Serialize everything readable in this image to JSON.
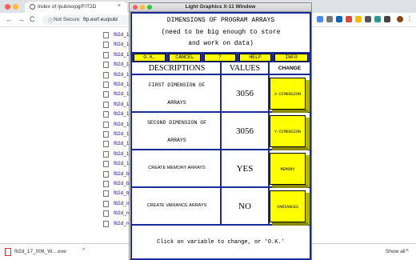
{
  "browser": {
    "tab_title": "Index of /pub/expg/FIT2D",
    "tab_close": "×",
    "new_tab": "+",
    "nav": {
      "back": "←",
      "forward": "→",
      "reload": "C"
    },
    "security_label": "Not Secure",
    "url": "ftp.esrf.eu/pub/",
    "menu": "⋮",
    "files": [
      "fit2d_12",
      "fit2d_12",
      "fit2d_12",
      "fit2d_12",
      "fit2d_12",
      "fit2d_14",
      "fit2d_14",
      "fit2d_16",
      "fit2d_16",
      "fit2d_17",
      "fit2d_17",
      "fit2d_17",
      "fit2d_17",
      "fit2d_17",
      "fit2d_be",
      "fit2d_be",
      "fit2d_be",
      "fit2d_im",
      "fit2d_re",
      "fit2d_re"
    ],
    "download": {
      "filename": "fit2d_17_006_W....exe",
      "caret": "^",
      "show_all": "Show all",
      "close": "×"
    }
  },
  "x11": {
    "window_title": "Light Graphics X-11 Window",
    "heading": [
      "DIMENSIONS OF PROGRAM ARRAYS",
      "(need to be big enough to store",
      "and work on data)"
    ],
    "buttons": [
      "O.K.",
      "CANCEL",
      "?",
      "HELP",
      "INFO"
    ],
    "headers": {
      "descriptions": "DESCRIPTIONS",
      "values": "VALUES",
      "change": "CHANGE"
    },
    "rows": [
      {
        "line1": "FIRST DIMENSION OF",
        "line2": "ARRAYS",
        "value": "3056",
        "change": "X-DIMENSION"
      },
      {
        "line1": "SECOND DIMENSION OF",
        "line2": "ARRAYS",
        "value": "3056",
        "change": "Y-DIMENSION"
      },
      {
        "line1": "CREATE MEMORY ARRAYS",
        "line2": "",
        "value": "YES",
        "change": "MEMORY"
      },
      {
        "line1": "CREATE VARIANCE ARRAYS",
        "line2": "",
        "value": "NO",
        "change": "VARIANCES"
      }
    ],
    "footer": "Click on variable to change, or 'O.K.'"
  },
  "colors": {
    "frame_blue": "#1a2b9a",
    "button_yellow": "#ffff00"
  }
}
